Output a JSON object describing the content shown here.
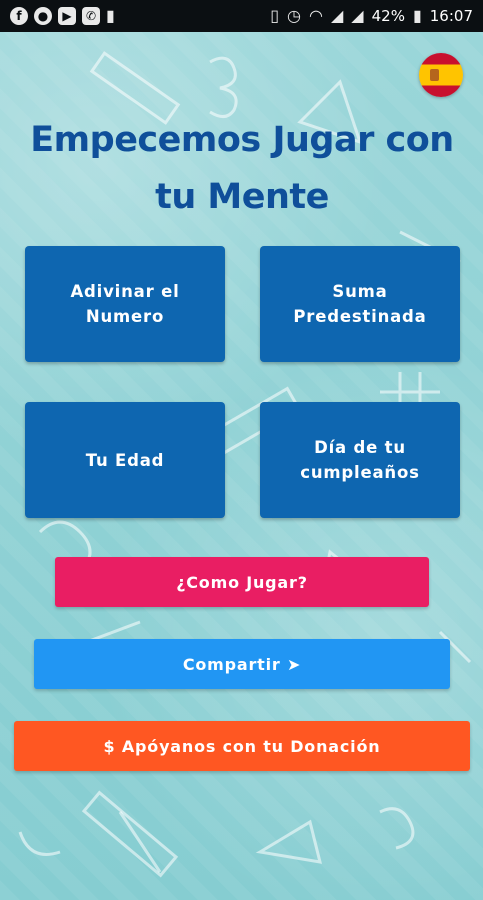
{
  "status_bar": {
    "app_icons": [
      "facebook-icon",
      "media-icon",
      "youtube-icon",
      "whatsapp-icon",
      "battery-saver-icon"
    ],
    "battery": "42%",
    "time": "16:07"
  },
  "flag": {
    "icon": "spain-flag-icon"
  },
  "title": "Empecemos Jugar con tu Mente",
  "cards": [
    {
      "label": "Adivinar el\nNumero"
    },
    {
      "label": "Suma\nPredestinada"
    },
    {
      "label": "Tu Edad"
    },
    {
      "label": "Día de tu\ncumpleaños"
    }
  ],
  "buttons": {
    "how_to_play": "¿Como Jugar?",
    "share": "Compartir ➤",
    "donate": "$ Apóyanos con tu Donación"
  },
  "colors": {
    "title": "#0f4f9a",
    "card": "#0e66b0",
    "how_to_play": "#e91e63",
    "share": "#2196f3",
    "donate": "#ff5722",
    "background": "#8fd0d4"
  }
}
